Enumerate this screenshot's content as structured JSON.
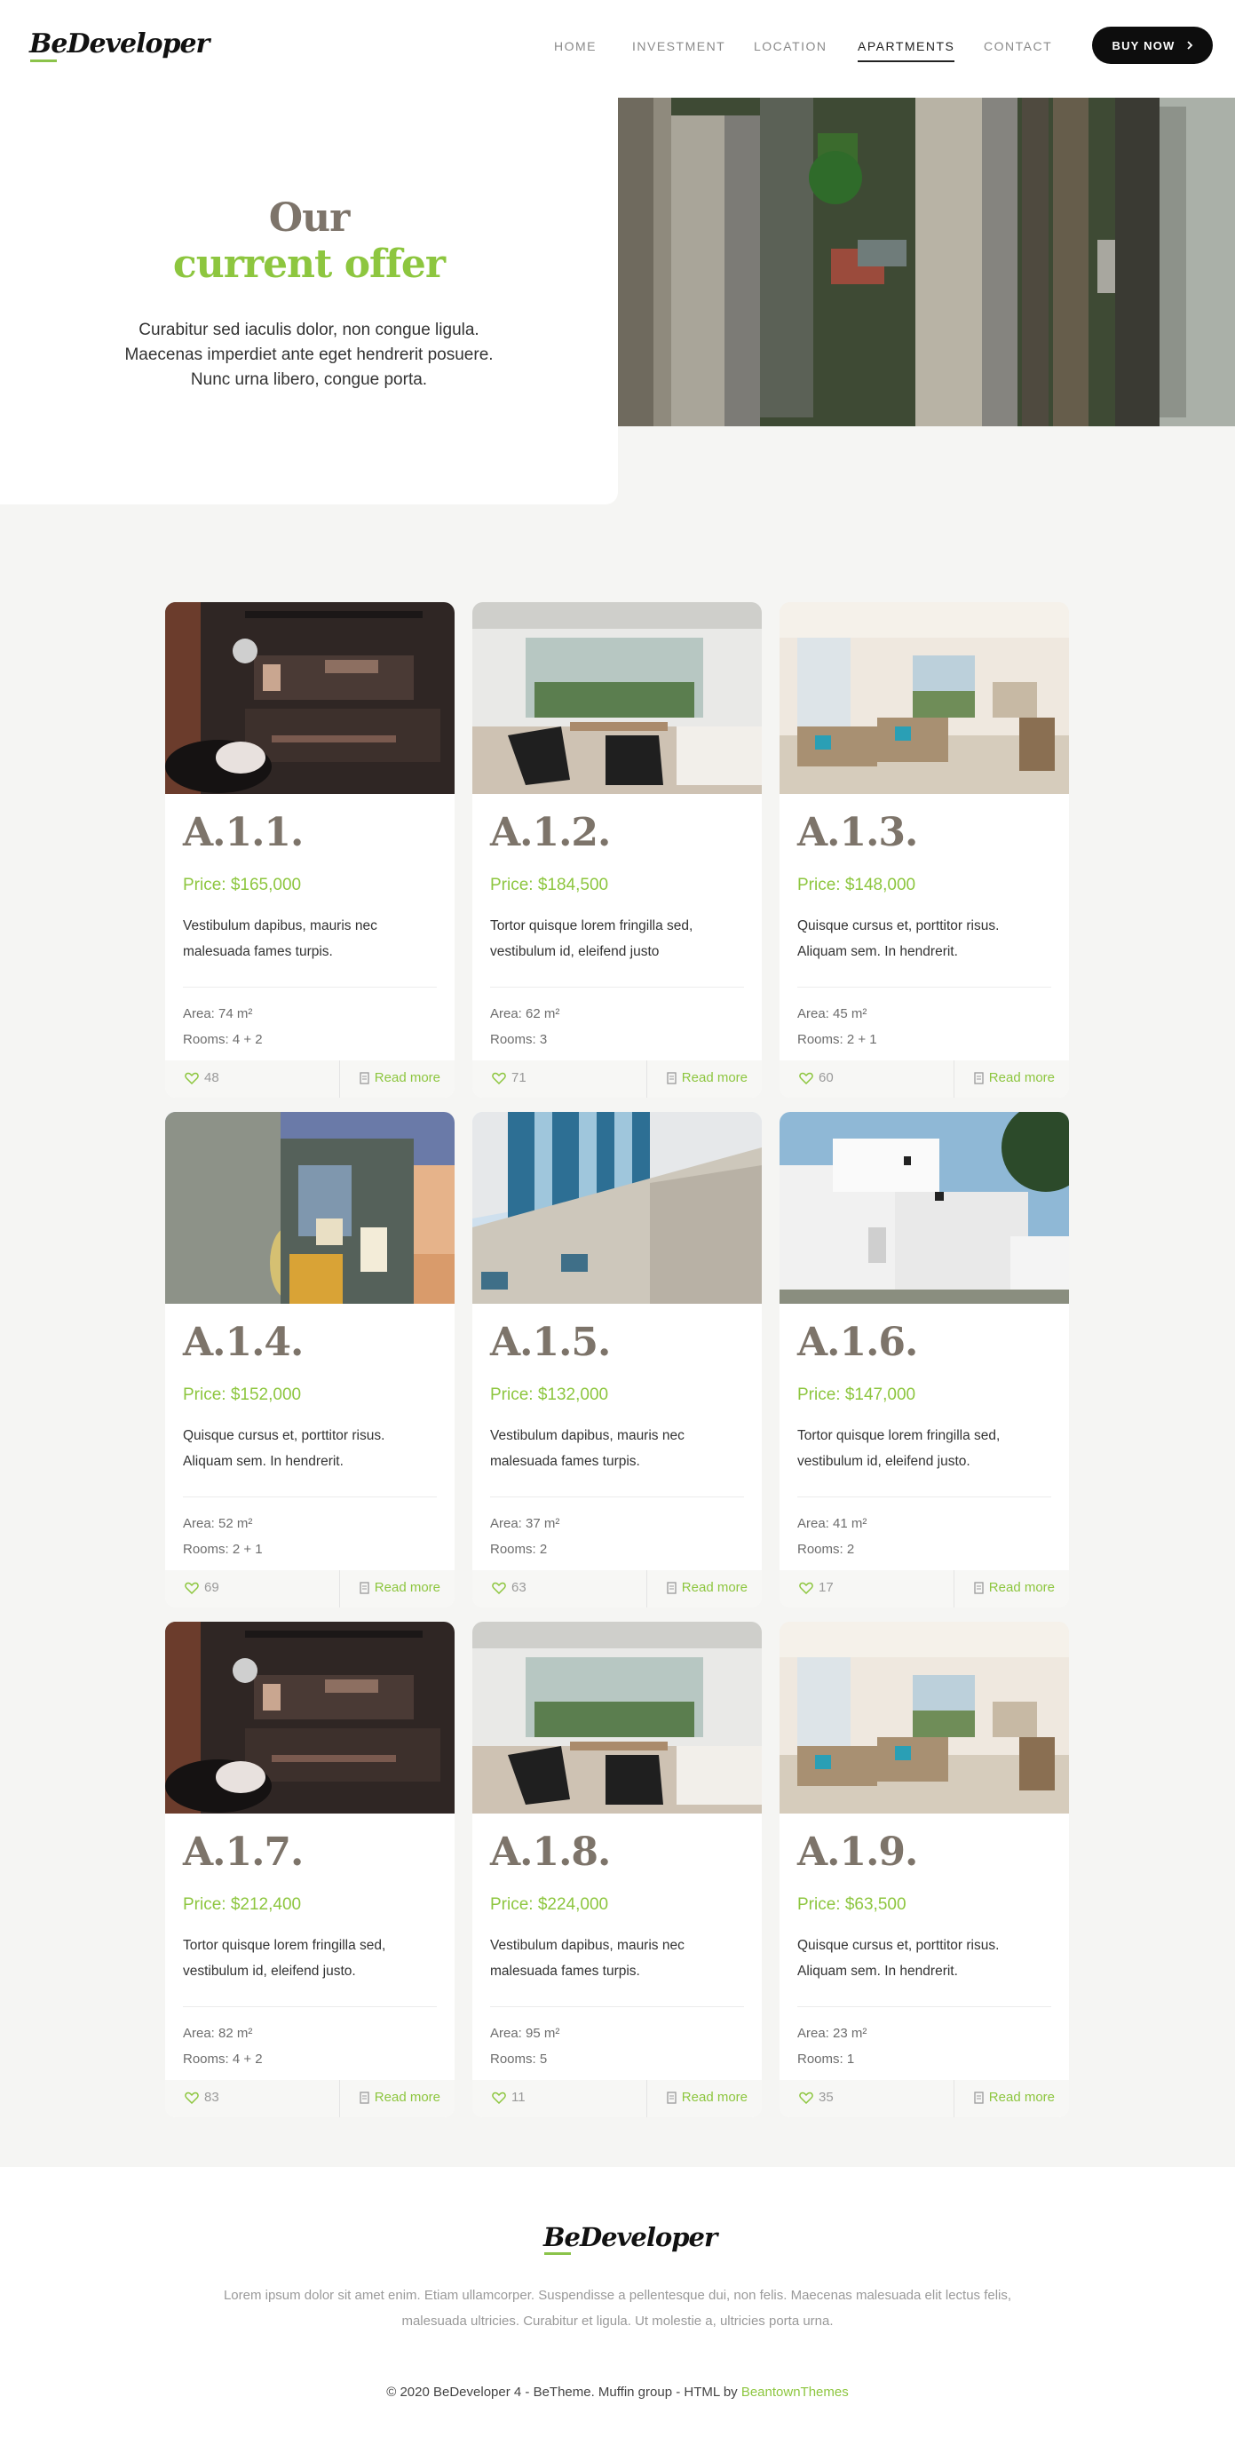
{
  "brand": {
    "logo": "BeDeveloper",
    "accent": "#8dc63f",
    "title_color": "#7d746a"
  },
  "nav": {
    "items": [
      "HOME",
      "INVESTMENT",
      "LOCATION",
      "APARTMENTS",
      "CONTACT"
    ],
    "active": "APARTMENTS",
    "cta": "BUY NOW",
    "cta_icon": "chevron-right-icon"
  },
  "hero": {
    "title_line1": "Our",
    "title_line2": "current offer",
    "text": [
      "Curabitur sed iaculis dolor, non congue ligula.",
      "Maecenas imperdiet ante eget hendrerit posuere.",
      "Nunc urna libero, congue porta."
    ]
  },
  "cards": [
    {
      "code": "A.1.1.",
      "price": "Price: $165,000",
      "desc": [
        "Vestibulum dapibus, mauris nec",
        "malesuada fames turpis."
      ],
      "area": "Area: 74 m²",
      "rooms": "Rooms: 4 + 2",
      "likes": "48",
      "read_more": "Read more",
      "photo": "loft"
    },
    {
      "code": "A.1.2.",
      "price": "Price: $184,500",
      "desc": [
        "Tortor quisque lorem fringilla sed,",
        "vestibulum id, eleifend justo"
      ],
      "area": "Area: 62 m²",
      "rooms": "Rooms: 3",
      "likes": "71",
      "read_more": "Read more",
      "photo": "living"
    },
    {
      "code": "A.1.3.",
      "price": "Price: $148,000",
      "desc": [
        "Quisque cursus et, porttitor risus.",
        "Aliquam sem. In hendrerit."
      ],
      "area": "Area: 45 m²",
      "rooms": "Rooms: 2 + 1",
      "likes": "60",
      "read_more": "Read more",
      "photo": "lounge"
    },
    {
      "code": "A.1.4.",
      "price": "Price: $152,000",
      "desc": [
        "Quisque cursus et, porttitor risus.",
        "Aliquam sem. In hendrerit."
      ],
      "area": "Area: 52 m²",
      "rooms": "Rooms: 2 + 1",
      "likes": "69",
      "read_more": "Read more",
      "photo": "house-dusk"
    },
    {
      "code": "A.1.5.",
      "price": "Price: $132,000",
      "desc": [
        "Vestibulum dapibus, mauris nec",
        "malesuada fames turpis."
      ],
      "area": "Area: 37 m²",
      "rooms": "Rooms: 2",
      "likes": "63",
      "read_more": "Read more",
      "photo": "facade"
    },
    {
      "code": "A.1.6.",
      "price": "Price: $147,000",
      "desc": [
        "Tortor quisque lorem fringilla sed,",
        "vestibulum id, eleifend justo."
      ],
      "area": "Area: 41 m²",
      "rooms": "Rooms: 2",
      "likes": "17",
      "read_more": "Read more",
      "photo": "white-house"
    },
    {
      "code": "A.1.7.",
      "price": "Price: $212,400",
      "desc": [
        "Tortor quisque lorem fringilla sed,",
        "vestibulum id, eleifend justo."
      ],
      "area": "Area: 82 m²",
      "rooms": "Rooms: 4 + 2",
      "likes": "83",
      "read_more": "Read more",
      "photo": "loft"
    },
    {
      "code": "A.1.8.",
      "price": "Price: $224,000",
      "desc": [
        "Vestibulum dapibus, mauris nec",
        "malesuada fames turpis."
      ],
      "area": "Area: 95 m²",
      "rooms": "Rooms: 5",
      "likes": "11",
      "read_more": "Read more",
      "photo": "living"
    },
    {
      "code": "A.1.9.",
      "price": "Price: $63,500",
      "desc": [
        "Quisque cursus et, porttitor risus.",
        "Aliquam sem. In hendrerit."
      ],
      "area": "Area: 23 m²",
      "rooms": "Rooms: 1",
      "likes": "35",
      "read_more": "Read more",
      "photo": "lounge"
    }
  ],
  "footer": {
    "logo": "BeDeveloper",
    "text": [
      "Lorem ipsum dolor sit amet enim. Etiam ullamcorper. Suspendisse a pellentesque dui, non felis. Maecenas malesuada elit lectus felis,",
      "malesuada ultricies. Curabitur et ligula. Ut molestie a, ultricies porta urna."
    ],
    "copyright": "© 2020 BeDeveloper 4 - BeTheme. Muffin group - HTML by",
    "copyright_link": "BeantownThemes"
  }
}
